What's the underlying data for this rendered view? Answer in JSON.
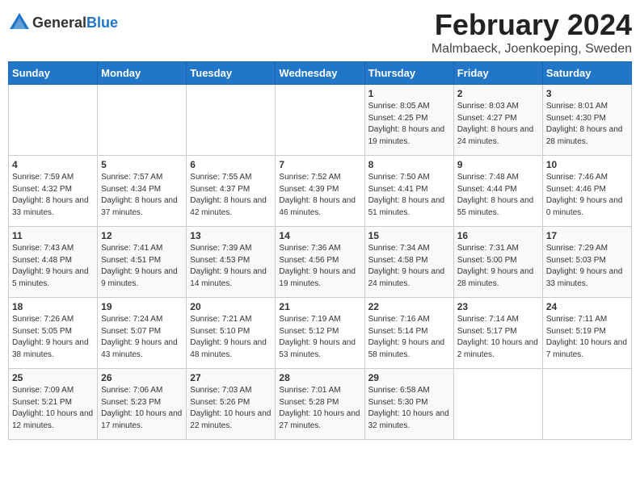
{
  "header": {
    "logo_general": "General",
    "logo_blue": "Blue",
    "title": "February 2024",
    "location": "Malmbaeck, Joenkoeping, Sweden"
  },
  "days_of_week": [
    "Sunday",
    "Monday",
    "Tuesday",
    "Wednesday",
    "Thursday",
    "Friday",
    "Saturday"
  ],
  "weeks": [
    [
      {
        "day": "",
        "info": ""
      },
      {
        "day": "",
        "info": ""
      },
      {
        "day": "",
        "info": ""
      },
      {
        "day": "",
        "info": ""
      },
      {
        "day": "1",
        "info": "Sunrise: 8:05 AM\nSunset: 4:25 PM\nDaylight: 8 hours\nand 19 minutes."
      },
      {
        "day": "2",
        "info": "Sunrise: 8:03 AM\nSunset: 4:27 PM\nDaylight: 8 hours\nand 24 minutes."
      },
      {
        "day": "3",
        "info": "Sunrise: 8:01 AM\nSunset: 4:30 PM\nDaylight: 8 hours\nand 28 minutes."
      }
    ],
    [
      {
        "day": "4",
        "info": "Sunrise: 7:59 AM\nSunset: 4:32 PM\nDaylight: 8 hours\nand 33 minutes."
      },
      {
        "day": "5",
        "info": "Sunrise: 7:57 AM\nSunset: 4:34 PM\nDaylight: 8 hours\nand 37 minutes."
      },
      {
        "day": "6",
        "info": "Sunrise: 7:55 AM\nSunset: 4:37 PM\nDaylight: 8 hours\nand 42 minutes."
      },
      {
        "day": "7",
        "info": "Sunrise: 7:52 AM\nSunset: 4:39 PM\nDaylight: 8 hours\nand 46 minutes."
      },
      {
        "day": "8",
        "info": "Sunrise: 7:50 AM\nSunset: 4:41 PM\nDaylight: 8 hours\nand 51 minutes."
      },
      {
        "day": "9",
        "info": "Sunrise: 7:48 AM\nSunset: 4:44 PM\nDaylight: 8 hours\nand 55 minutes."
      },
      {
        "day": "10",
        "info": "Sunrise: 7:46 AM\nSunset: 4:46 PM\nDaylight: 9 hours\nand 0 minutes."
      }
    ],
    [
      {
        "day": "11",
        "info": "Sunrise: 7:43 AM\nSunset: 4:48 PM\nDaylight: 9 hours\nand 5 minutes."
      },
      {
        "day": "12",
        "info": "Sunrise: 7:41 AM\nSunset: 4:51 PM\nDaylight: 9 hours\nand 9 minutes."
      },
      {
        "day": "13",
        "info": "Sunrise: 7:39 AM\nSunset: 4:53 PM\nDaylight: 9 hours\nand 14 minutes."
      },
      {
        "day": "14",
        "info": "Sunrise: 7:36 AM\nSunset: 4:56 PM\nDaylight: 9 hours\nand 19 minutes."
      },
      {
        "day": "15",
        "info": "Sunrise: 7:34 AM\nSunset: 4:58 PM\nDaylight: 9 hours\nand 24 minutes."
      },
      {
        "day": "16",
        "info": "Sunrise: 7:31 AM\nSunset: 5:00 PM\nDaylight: 9 hours\nand 28 minutes."
      },
      {
        "day": "17",
        "info": "Sunrise: 7:29 AM\nSunset: 5:03 PM\nDaylight: 9 hours\nand 33 minutes."
      }
    ],
    [
      {
        "day": "18",
        "info": "Sunrise: 7:26 AM\nSunset: 5:05 PM\nDaylight: 9 hours\nand 38 minutes."
      },
      {
        "day": "19",
        "info": "Sunrise: 7:24 AM\nSunset: 5:07 PM\nDaylight: 9 hours\nand 43 minutes."
      },
      {
        "day": "20",
        "info": "Sunrise: 7:21 AM\nSunset: 5:10 PM\nDaylight: 9 hours\nand 48 minutes."
      },
      {
        "day": "21",
        "info": "Sunrise: 7:19 AM\nSunset: 5:12 PM\nDaylight: 9 hours\nand 53 minutes."
      },
      {
        "day": "22",
        "info": "Sunrise: 7:16 AM\nSunset: 5:14 PM\nDaylight: 9 hours\nand 58 minutes."
      },
      {
        "day": "23",
        "info": "Sunrise: 7:14 AM\nSunset: 5:17 PM\nDaylight: 10 hours\nand 2 minutes."
      },
      {
        "day": "24",
        "info": "Sunrise: 7:11 AM\nSunset: 5:19 PM\nDaylight: 10 hours\nand 7 minutes."
      }
    ],
    [
      {
        "day": "25",
        "info": "Sunrise: 7:09 AM\nSunset: 5:21 PM\nDaylight: 10 hours\nand 12 minutes."
      },
      {
        "day": "26",
        "info": "Sunrise: 7:06 AM\nSunset: 5:23 PM\nDaylight: 10 hours\nand 17 minutes."
      },
      {
        "day": "27",
        "info": "Sunrise: 7:03 AM\nSunset: 5:26 PM\nDaylight: 10 hours\nand 22 minutes."
      },
      {
        "day": "28",
        "info": "Sunrise: 7:01 AM\nSunset: 5:28 PM\nDaylight: 10 hours\nand 27 minutes."
      },
      {
        "day": "29",
        "info": "Sunrise: 6:58 AM\nSunset: 5:30 PM\nDaylight: 10 hours\nand 32 minutes."
      },
      {
        "day": "",
        "info": ""
      },
      {
        "day": "",
        "info": ""
      }
    ]
  ]
}
